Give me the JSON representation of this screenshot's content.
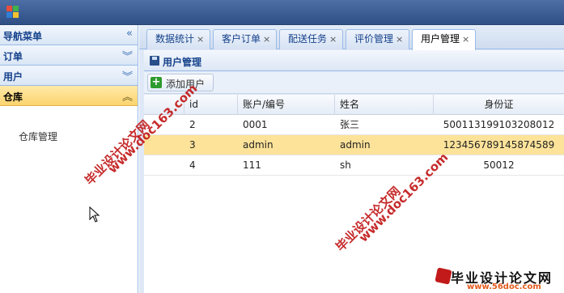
{
  "sidebar": {
    "sections": [
      {
        "label": "导航菜单",
        "chevron": "«"
      },
      {
        "label": "订单",
        "chevron": "︾"
      },
      {
        "label": "用户",
        "chevron": "︾"
      },
      {
        "label": "仓库",
        "chevron": "︽"
      }
    ],
    "active_item": "仓库管理"
  },
  "tabs": [
    {
      "label": "数据统计",
      "close": "×"
    },
    {
      "label": "客户订单",
      "close": "×"
    },
    {
      "label": "配送任务",
      "close": "×"
    },
    {
      "label": "评价管理",
      "close": "×"
    },
    {
      "label": "用户管理",
      "close": "×"
    }
  ],
  "panel": {
    "title": "用户管理",
    "add_label": "添加用户"
  },
  "grid": {
    "columns": [
      "id",
      "账户/编号",
      "姓名",
      "身份证"
    ],
    "rows": [
      [
        "2",
        "0001",
        "张三",
        "500113199103208012"
      ],
      [
        "3",
        "admin",
        "admin",
        "123456789145874589"
      ],
      [
        "4",
        "111",
        "sh",
        "50012"
      ]
    ]
  },
  "watermarks": {
    "site_url": "www.doc163.com",
    "site_name": "毕业设计论文网",
    "brand_title": "毕业设计论文网",
    "brand_url": "www.56doc.com"
  },
  "colors": {
    "selected_row": "#fde39a",
    "active_section": "#fcd46e",
    "header_blue": "#15428b"
  }
}
